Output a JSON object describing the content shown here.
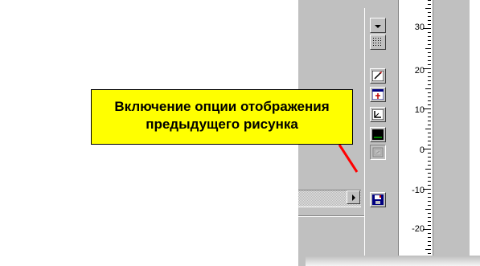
{
  "callout": {
    "line1": "Включение опции отображения",
    "line2": "предыдущего рисунка"
  },
  "ruler": {
    "labels": [
      "30",
      "20",
      "10",
      "0",
      "-10",
      "-20"
    ]
  },
  "toolbar": {
    "buttons": [
      {
        "icon": "dropdown-arrow-icon"
      },
      {
        "icon": "grid-icon"
      },
      {
        "icon": "pen-edit-icon"
      },
      {
        "icon": "insert-frame-icon"
      },
      {
        "icon": "angle-corner-icon"
      },
      {
        "icon": "black-screen-icon"
      },
      {
        "icon": "previous-drawing-icon"
      },
      {
        "icon": "save-disk-icon"
      }
    ]
  },
  "colors": {
    "callout_bg": "#ffff00",
    "pointer": "#ff0000",
    "chrome": "#c0c0c0"
  }
}
